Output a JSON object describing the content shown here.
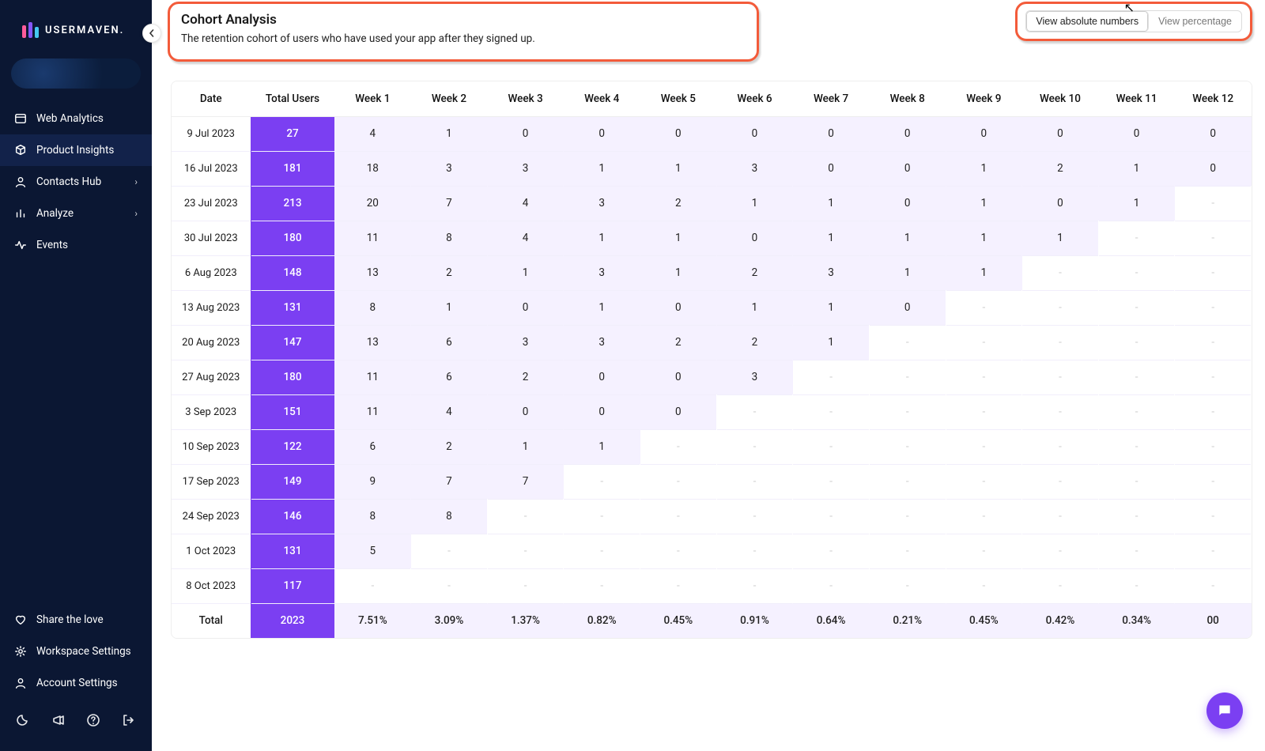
{
  "brand": {
    "name": "USERMAVEN."
  },
  "sidebar": {
    "items": [
      {
        "label": "Web Analytics",
        "icon": "window-icon",
        "chevron": false
      },
      {
        "label": "Product Insights",
        "icon": "cube-icon",
        "chevron": false,
        "active": true
      },
      {
        "label": "Contacts Hub",
        "icon": "user-icon",
        "chevron": true
      },
      {
        "label": "Analyze",
        "icon": "bars-icon",
        "chevron": true
      },
      {
        "label": "Events",
        "icon": "activity-icon",
        "chevron": false
      }
    ],
    "bottom": [
      {
        "label": "Share the love",
        "icon": "heart-icon"
      },
      {
        "label": "Workspace Settings",
        "icon": "gear-icon"
      },
      {
        "label": "Account Settings",
        "icon": "user-icon"
      }
    ],
    "strip": [
      "moon-icon",
      "megaphone-icon",
      "help-icon",
      "logout-icon"
    ]
  },
  "header": {
    "title": "Cohort Analysis",
    "subtitle": "The retention cohort of users who have used your app after they signed up."
  },
  "toggle": {
    "absolute": "View absolute numbers",
    "percentage": "View percentage"
  },
  "table": {
    "columns": [
      "Date",
      "Total Users",
      "Week 1",
      "Week 2",
      "Week 3",
      "Week 4",
      "Week 5",
      "Week 6",
      "Week 7",
      "Week 8",
      "Week 9",
      "Week 10",
      "Week 11",
      "Week 12"
    ],
    "rows": [
      {
        "date": "9 Jul 2023",
        "total": "27",
        "weeks": [
          "4",
          "1",
          "0",
          "0",
          "0",
          "0",
          "0",
          "0",
          "0",
          "0",
          "0",
          "0"
        ]
      },
      {
        "date": "16 Jul 2023",
        "total": "181",
        "weeks": [
          "18",
          "3",
          "3",
          "1",
          "1",
          "3",
          "0",
          "0",
          "1",
          "2",
          "1",
          "0"
        ]
      },
      {
        "date": "23 Jul 2023",
        "total": "213",
        "weeks": [
          "20",
          "7",
          "4",
          "3",
          "2",
          "1",
          "1",
          "0",
          "1",
          "0",
          "1",
          null
        ]
      },
      {
        "date": "30 Jul 2023",
        "total": "180",
        "weeks": [
          "11",
          "8",
          "4",
          "1",
          "1",
          "0",
          "1",
          "1",
          "1",
          "1",
          null,
          null
        ]
      },
      {
        "date": "6 Aug 2023",
        "total": "148",
        "weeks": [
          "13",
          "2",
          "1",
          "3",
          "1",
          "2",
          "3",
          "1",
          "1",
          null,
          null,
          null
        ]
      },
      {
        "date": "13 Aug 2023",
        "total": "131",
        "weeks": [
          "8",
          "1",
          "0",
          "1",
          "0",
          "1",
          "1",
          "0",
          null,
          null,
          null,
          null
        ]
      },
      {
        "date": "20 Aug 2023",
        "total": "147",
        "weeks": [
          "13",
          "6",
          "3",
          "3",
          "2",
          "2",
          "1",
          null,
          null,
          null,
          null,
          null
        ]
      },
      {
        "date": "27 Aug 2023",
        "total": "180",
        "weeks": [
          "11",
          "6",
          "2",
          "0",
          "0",
          "3",
          null,
          null,
          null,
          null,
          null,
          null
        ]
      },
      {
        "date": "3 Sep 2023",
        "total": "151",
        "weeks": [
          "11",
          "4",
          "0",
          "0",
          "0",
          null,
          null,
          null,
          null,
          null,
          null,
          null
        ]
      },
      {
        "date": "10 Sep 2023",
        "total": "122",
        "weeks": [
          "6",
          "2",
          "1",
          "1",
          null,
          null,
          null,
          null,
          null,
          null,
          null,
          null
        ]
      },
      {
        "date": "17 Sep 2023",
        "total": "149",
        "weeks": [
          "9",
          "7",
          "7",
          null,
          null,
          null,
          null,
          null,
          null,
          null,
          null,
          null
        ]
      },
      {
        "date": "24 Sep 2023",
        "total": "146",
        "weeks": [
          "8",
          "8",
          null,
          null,
          null,
          null,
          null,
          null,
          null,
          null,
          null,
          null
        ]
      },
      {
        "date": "1 Oct 2023",
        "total": "131",
        "weeks": [
          "5",
          null,
          null,
          null,
          null,
          null,
          null,
          null,
          null,
          null,
          null,
          null
        ]
      },
      {
        "date": "8 Oct 2023",
        "total": "117",
        "weeks": [
          null,
          null,
          null,
          null,
          null,
          null,
          null,
          null,
          null,
          null,
          null,
          null
        ]
      }
    ],
    "footer": {
      "label": "Total",
      "total": "2023",
      "weeks": [
        "7.51%",
        "3.09%",
        "1.37%",
        "0.82%",
        "0.45%",
        "0.91%",
        "0.64%",
        "0.21%",
        "0.45%",
        "0.42%",
        "0.34%",
        "00"
      ]
    }
  },
  "future_marker": "-"
}
